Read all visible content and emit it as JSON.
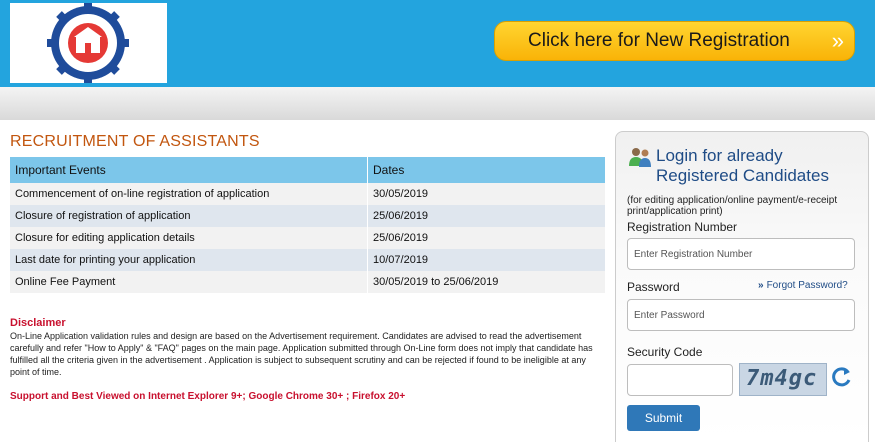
{
  "header": {
    "registration_button": "Click here for New Registration"
  },
  "main": {
    "title": "RECRUITMENT OF ASSISTANTS",
    "table": {
      "headers": [
        "Important Events",
        "Dates"
      ],
      "rows": [
        [
          "Commencement of on-line registration of application",
          "30/05/2019"
        ],
        [
          "Closure of registration of application",
          "25/06/2019"
        ],
        [
          "Closure for editing application details",
          "25/06/2019"
        ],
        [
          "Last date for printing your application",
          "10/07/2019"
        ],
        [
          "Online Fee Payment",
          "30/05/2019 to 25/06/2019"
        ]
      ]
    },
    "disclaimer_heading": "Disclaimer",
    "disclaimer_text": "On-Line Application validation rules and design are based on the Advertisement requirement. Candidates are advised to read the advertisement carefully and refer \"How to Apply\" & \"FAQ\" pages on the main page. Application submitted through On-Line form does not imply that candidate has fulfilled all the criteria given in the advertisement . Application is subject to subsequent scrutiny and can be rejected if found to be ineligible at any point of time.",
    "support_text": "Support and Best Viewed on Internet Explorer 9+; Google Chrome 30+ ; Firefox 20+"
  },
  "login": {
    "title_line1": "Login for already",
    "title_line2": "Registered Candidates",
    "subtitle": "(for editing application/online payment/e-receipt print/application print)",
    "registration_label": "Registration Number",
    "registration_placeholder": "Enter Registration Number",
    "password_label": "Password",
    "password_placeholder": "Enter Password",
    "forgot_password": "Forgot Password?",
    "security_code_label": "Security Code",
    "captcha_text": "7m4gc",
    "submit_label": "Submit"
  },
  "colors": {
    "header_blue": "#23a4de",
    "button_yellow": "#fbbd11",
    "title_orange": "#c2560f",
    "disclaimer_red": "#c8102e",
    "login_blue": "#1f4c86",
    "table_header": "#7cc6ea"
  },
  "icons": [
    "epfo-logo",
    "double-chevron-right-icon",
    "users-icon",
    "double-chevron-right-small-icon",
    "refresh-icon"
  ]
}
